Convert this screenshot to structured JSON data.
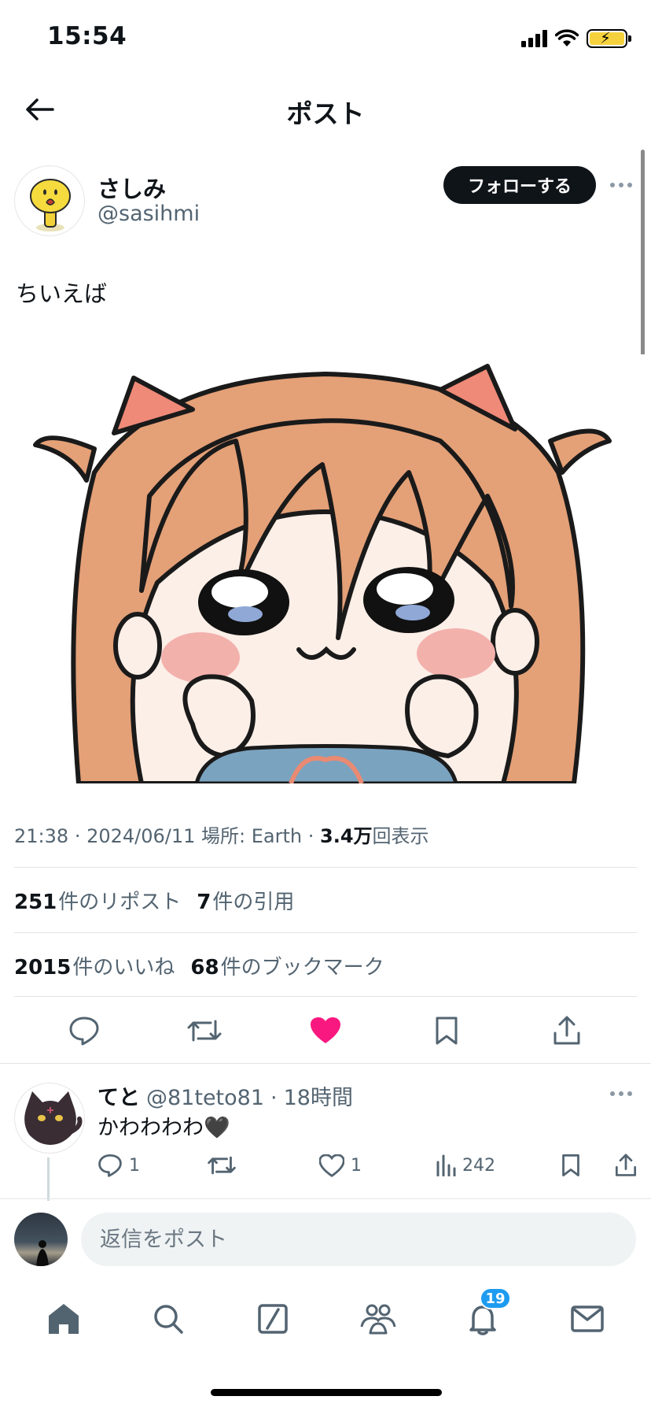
{
  "status_bar": {
    "time": "15:54"
  },
  "header": {
    "title": "ポスト"
  },
  "post": {
    "author_name": "さしみ",
    "author_handle": "@sasihmi",
    "follow_label": "フォローする",
    "text": "ちいえば",
    "meta": {
      "time": "21:38",
      "date": "2024/06/11",
      "location": "場所: Earth",
      "views_value": "3.4",
      "views_unit": "万",
      "views_label": "回表示"
    },
    "stats": {
      "reposts_count": "251",
      "reposts_label": "件のリポスト",
      "quotes_count": "7",
      "quotes_label": "件の引用",
      "likes_count": "2015",
      "likes_label": "件のいいね",
      "bookmarks_count": "68",
      "bookmarks_label": "件のブックマーク"
    },
    "liked": true
  },
  "reply": {
    "name": "てと",
    "handle": "@81teto81",
    "time": "18時間",
    "text": "かわわわわ🖤",
    "reply_count": "1",
    "like_count": "1",
    "views": "242"
  },
  "compose": {
    "placeholder": "返信をポスト"
  },
  "tab_bar": {
    "notification_count": "19"
  },
  "colors": {
    "like": "#f91880",
    "accent": "#1d9bf0",
    "follow_bg": "#0f1419"
  }
}
